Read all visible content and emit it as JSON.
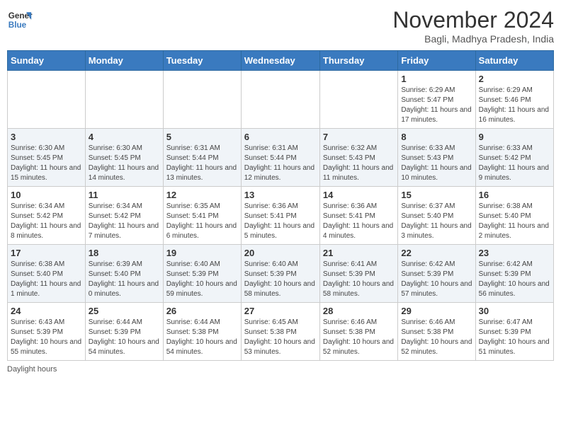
{
  "logo": {
    "line1": "General",
    "line2": "Blue"
  },
  "title": "November 2024",
  "subtitle": "Bagli, Madhya Pradesh, India",
  "days": [
    "Sunday",
    "Monday",
    "Tuesday",
    "Wednesday",
    "Thursday",
    "Friday",
    "Saturday"
  ],
  "weeks": [
    [
      {
        "day": "",
        "info": ""
      },
      {
        "day": "",
        "info": ""
      },
      {
        "day": "",
        "info": ""
      },
      {
        "day": "",
        "info": ""
      },
      {
        "day": "",
        "info": ""
      },
      {
        "day": "1",
        "info": "Sunrise: 6:29 AM\nSunset: 5:47 PM\nDaylight: 11 hours and 17 minutes."
      },
      {
        "day": "2",
        "info": "Sunrise: 6:29 AM\nSunset: 5:46 PM\nDaylight: 11 hours and 16 minutes."
      }
    ],
    [
      {
        "day": "3",
        "info": "Sunrise: 6:30 AM\nSunset: 5:45 PM\nDaylight: 11 hours and 15 minutes."
      },
      {
        "day": "4",
        "info": "Sunrise: 6:30 AM\nSunset: 5:45 PM\nDaylight: 11 hours and 14 minutes."
      },
      {
        "day": "5",
        "info": "Sunrise: 6:31 AM\nSunset: 5:44 PM\nDaylight: 11 hours and 13 minutes."
      },
      {
        "day": "6",
        "info": "Sunrise: 6:31 AM\nSunset: 5:44 PM\nDaylight: 11 hours and 12 minutes."
      },
      {
        "day": "7",
        "info": "Sunrise: 6:32 AM\nSunset: 5:43 PM\nDaylight: 11 hours and 11 minutes."
      },
      {
        "day": "8",
        "info": "Sunrise: 6:33 AM\nSunset: 5:43 PM\nDaylight: 11 hours and 10 minutes."
      },
      {
        "day": "9",
        "info": "Sunrise: 6:33 AM\nSunset: 5:42 PM\nDaylight: 11 hours and 9 minutes."
      }
    ],
    [
      {
        "day": "10",
        "info": "Sunrise: 6:34 AM\nSunset: 5:42 PM\nDaylight: 11 hours and 8 minutes."
      },
      {
        "day": "11",
        "info": "Sunrise: 6:34 AM\nSunset: 5:42 PM\nDaylight: 11 hours and 7 minutes."
      },
      {
        "day": "12",
        "info": "Sunrise: 6:35 AM\nSunset: 5:41 PM\nDaylight: 11 hours and 6 minutes."
      },
      {
        "day": "13",
        "info": "Sunrise: 6:36 AM\nSunset: 5:41 PM\nDaylight: 11 hours and 5 minutes."
      },
      {
        "day": "14",
        "info": "Sunrise: 6:36 AM\nSunset: 5:41 PM\nDaylight: 11 hours and 4 minutes."
      },
      {
        "day": "15",
        "info": "Sunrise: 6:37 AM\nSunset: 5:40 PM\nDaylight: 11 hours and 3 minutes."
      },
      {
        "day": "16",
        "info": "Sunrise: 6:38 AM\nSunset: 5:40 PM\nDaylight: 11 hours and 2 minutes."
      }
    ],
    [
      {
        "day": "17",
        "info": "Sunrise: 6:38 AM\nSunset: 5:40 PM\nDaylight: 11 hours and 1 minute."
      },
      {
        "day": "18",
        "info": "Sunrise: 6:39 AM\nSunset: 5:40 PM\nDaylight: 11 hours and 0 minutes."
      },
      {
        "day": "19",
        "info": "Sunrise: 6:40 AM\nSunset: 5:39 PM\nDaylight: 10 hours and 59 minutes."
      },
      {
        "day": "20",
        "info": "Sunrise: 6:40 AM\nSunset: 5:39 PM\nDaylight: 10 hours and 58 minutes."
      },
      {
        "day": "21",
        "info": "Sunrise: 6:41 AM\nSunset: 5:39 PM\nDaylight: 10 hours and 58 minutes."
      },
      {
        "day": "22",
        "info": "Sunrise: 6:42 AM\nSunset: 5:39 PM\nDaylight: 10 hours and 57 minutes."
      },
      {
        "day": "23",
        "info": "Sunrise: 6:42 AM\nSunset: 5:39 PM\nDaylight: 10 hours and 56 minutes."
      }
    ],
    [
      {
        "day": "24",
        "info": "Sunrise: 6:43 AM\nSunset: 5:39 PM\nDaylight: 10 hours and 55 minutes."
      },
      {
        "day": "25",
        "info": "Sunrise: 6:44 AM\nSunset: 5:39 PM\nDaylight: 10 hours and 54 minutes."
      },
      {
        "day": "26",
        "info": "Sunrise: 6:44 AM\nSunset: 5:38 PM\nDaylight: 10 hours and 54 minutes."
      },
      {
        "day": "27",
        "info": "Sunrise: 6:45 AM\nSunset: 5:38 PM\nDaylight: 10 hours and 53 minutes."
      },
      {
        "day": "28",
        "info": "Sunrise: 6:46 AM\nSunset: 5:38 PM\nDaylight: 10 hours and 52 minutes."
      },
      {
        "day": "29",
        "info": "Sunrise: 6:46 AM\nSunset: 5:38 PM\nDaylight: 10 hours and 52 minutes."
      },
      {
        "day": "30",
        "info": "Sunrise: 6:47 AM\nSunset: 5:39 PM\nDaylight: 10 hours and 51 minutes."
      }
    ]
  ],
  "footer": "Daylight hours"
}
